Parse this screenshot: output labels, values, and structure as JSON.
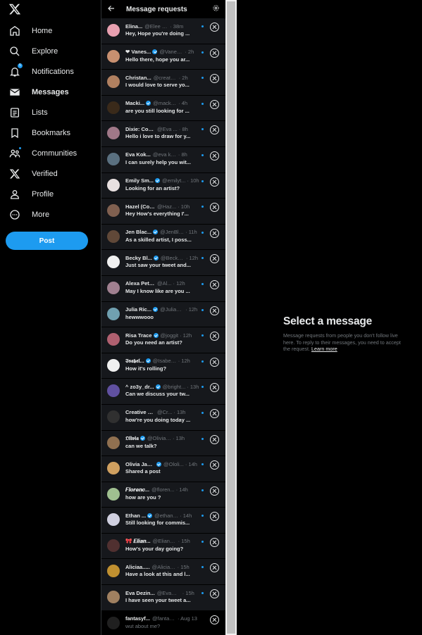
{
  "nav": {
    "items": [
      {
        "label": "Home",
        "icon": "home-icon"
      },
      {
        "label": "Explore",
        "icon": "search-icon"
      },
      {
        "label": "Notifications",
        "icon": "bell-icon",
        "badge": "5"
      },
      {
        "label": "Messages",
        "icon": "mail-icon"
      },
      {
        "label": "Lists",
        "icon": "list-icon"
      },
      {
        "label": "Bookmarks",
        "icon": "bookmark-icon"
      },
      {
        "label": "Communities",
        "icon": "people-icon"
      },
      {
        "label": "Verified",
        "icon": "x-logo-icon"
      },
      {
        "label": "Profile",
        "icon": "person-icon"
      },
      {
        "label": "More",
        "icon": "more-circle-icon"
      }
    ],
    "post_label": "Post"
  },
  "panel": {
    "title": "Message requests"
  },
  "requests": [
    {
      "name": "Elina...",
      "handle": "@Elee desi...",
      "time": "· 38m",
      "preview": "Hey, Hope you're doing ...",
      "verified": false,
      "unread": true,
      "avatar_color": "#e8a0b0"
    },
    {
      "name": "❤ Vanes...",
      "handle": "@Vanee...",
      "time": "· 2h",
      "preview": "Hello there, hope you ar...",
      "verified": true,
      "unread": true,
      "avatar_color": "#c89070"
    },
    {
      "name": "Christan...",
      "handle": "@create chri...",
      "time": "· 2h",
      "preview": "I would love to serve yo...",
      "verified": false,
      "unread": true,
      "avatar_color": "#b08060"
    },
    {
      "name": "Macki...",
      "handle": "@mackieb...",
      "time": "· 4h",
      "preview": "are you still looking for ...",
      "verified": true,
      "unread": true,
      "avatar_color": "#3a2a1a"
    },
    {
      "name": "Dixie: Commis...",
      "handle": "@Eva ...",
      "time": "· 8h",
      "preview": "Hello i love to draw for y...",
      "verified": false,
      "unread": true,
      "avatar_color": "#a07888"
    },
    {
      "name": "Eva Kok...",
      "handle": "@eva kok...",
      "time": "· 8h",
      "preview": "I can surely help you wit...",
      "verified": false,
      "unread": true,
      "avatar_color": "#5a7080"
    },
    {
      "name": "Emily Sm...",
      "handle": "@emilyt...",
      "time": "· 10h",
      "preview": "Looking for an artist?",
      "verified": true,
      "unread": true,
      "avatar_color": "#e8e0e0"
    },
    {
      "name": "Hazel (Com...",
      "handle": "@Haz...",
      "time": "· 10h",
      "preview": "Hey How's everything I'...",
      "verified": false,
      "unread": true,
      "avatar_color": "#806050"
    },
    {
      "name": "Jen Blac...",
      "handle": "@JenBla...",
      "time": "· 11h",
      "preview": "As a skilled artist, I poss...",
      "verified": true,
      "unread": true,
      "avatar_color": "#604838"
    },
    {
      "name": "Becky Bl...",
      "handle": "@Becky ...",
      "time": "· 12h",
      "preview": "Just saw your tweet and...",
      "verified": true,
      "unread": true,
      "avatar_color": "#f0f0f0"
    },
    {
      "name": "Alexa Peter ...",
      "handle": "@Al...",
      "time": "· 12h",
      "preview": "May I know like are you ...",
      "verified": false,
      "unread": true,
      "avatar_color": "#a08090"
    },
    {
      "name": "Julia Ric...",
      "handle": "@JuliaRi...",
      "time": "· 12h",
      "preview": "hewwwooo",
      "verified": true,
      "unread": true,
      "avatar_color": "#70a0b0"
    },
    {
      "name": "Risa Trace",
      "handle": "@joggit",
      "time": "· 12h",
      "preview": "Do you need an artist?",
      "verified": true,
      "unread": true,
      "avatar_color": "#b06070"
    },
    {
      "name": "𝕴𝖘𝖆𝖇𝖊𝖑...",
      "handle": "@Isabell...",
      "time": "· 12h",
      "preview": "How it's rolling?",
      "verified": true,
      "unread": true,
      "avatar_color": "#f0f0f0"
    },
    {
      "name": "^ zo3y_dr...",
      "handle": "@bright...",
      "time": "· 13h",
      "preview": "Can we discuss your tw...",
      "verified": true,
      "unread": true,
      "avatar_color": "#6050a0"
    },
    {
      "name": "Creative Girl ...",
      "handle": "@Cr...",
      "time": "· 13h",
      "preview": "how're you doing today ...",
      "verified": false,
      "unread": true,
      "avatar_color": "#303030"
    },
    {
      "name": "𝕺𝖑𝖎𝖛𝖎𝖆",
      "handle": "@Olivia B...",
      "time": "· 13h",
      "preview": "can we talk?",
      "verified": true,
      "unread": true,
      "avatar_color": "#907050"
    },
    {
      "name": "Olivia Jam...",
      "handle": "@Ololi...",
      "time": "· 14h",
      "preview": "Shared a post",
      "verified": true,
      "unread": true,
      "avatar_color": "#d0a060"
    },
    {
      "name": "𝑭𝒍𝒐𝒓𝒆𝒏𝒄...",
      "handle": "@floren...",
      "time": "· 14h",
      "preview": "how are you ?",
      "verified": false,
      "unread": true,
      "avatar_color": "#a0c090"
    },
    {
      "name": "Ethan ...",
      "handle": "@ethanha...",
      "time": "· 14h",
      "preview": "Still looking for commis...",
      "verified": true,
      "unread": true,
      "avatar_color": "#d0d0e0"
    },
    {
      "name": "🎀 𝑬𝒍𝒊𝒂𝒏...",
      "handle": "@Eliana0...",
      "time": "· 15h",
      "preview": "How's your day going?",
      "verified": false,
      "unread": true,
      "avatar_color": "#503030"
    },
    {
      "name": "Aliciaa.....",
      "handle": "@AliciaRoza...",
      "time": "· 15h",
      "preview": "Have a look at this and l...",
      "verified": false,
      "unread": true,
      "avatar_color": "#c09030"
    },
    {
      "name": "Eva Dezin...",
      "handle": "@EvaMille...",
      "time": "· 15h",
      "preview": "I have seen your tweet a...",
      "verified": false,
      "unread": true,
      "avatar_color": "#a08060"
    },
    {
      "name": "fantasyf...",
      "handle": "@fantasyf...",
      "time": "· Aug 13",
      "preview": "wut about me?",
      "verified": false,
      "unread": false,
      "avatar_color": "#202020"
    }
  ],
  "empty_state": {
    "title": "Select a message",
    "description": "Message requests from people you don't follow live here. To reply to their messages, you need to accept the request.",
    "link": "Learn more"
  },
  "colors": {
    "accent": "#1d9bf0",
    "background": "#000000",
    "row_background": "#16181c",
    "muted_text": "#71767b"
  }
}
